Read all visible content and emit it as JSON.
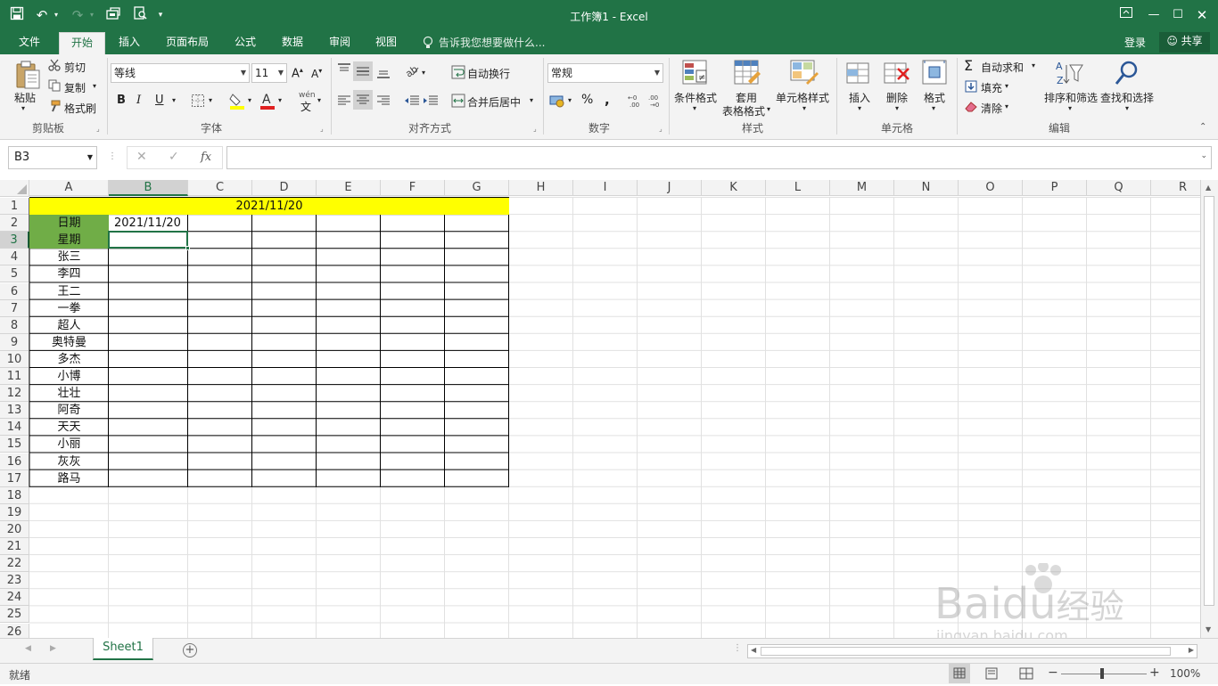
{
  "window": {
    "title": "工作簿1 - Excel"
  },
  "ribbon_tabs": [
    "文件",
    "开始",
    "插入",
    "页面布局",
    "公式",
    "数据",
    "审阅",
    "视图"
  ],
  "active_tab": "开始",
  "tell_me": "告诉我您想要做什么...",
  "account": {
    "login": "登录",
    "share": "共享"
  },
  "clipboard": {
    "paste": "粘贴",
    "cut": "剪切",
    "copy": "复制",
    "format_painter": "格式刷",
    "label": "剪贴板"
  },
  "font": {
    "name": "等线",
    "size": "11",
    "bold": "B",
    "italic": "I",
    "underline": "U",
    "label": "字体",
    "phonetic": "wén"
  },
  "alignment": {
    "wrap_text": "自动换行",
    "merge_center": "合并后居中",
    "label": "对齐方式"
  },
  "number": {
    "format": "常规",
    "percent": "%",
    "comma": ",",
    "label": "数字"
  },
  "styles": {
    "conditional": "条件格式",
    "table_format_1": "套用",
    "table_format_2": "表格格式",
    "cell_styles": "单元格样式",
    "label": "样式"
  },
  "cells": {
    "insert": "插入",
    "delete": "删除",
    "format": "格式",
    "label": "单元格"
  },
  "editing": {
    "autosum": "自动求和",
    "fill": "填充",
    "clear": "清除",
    "sort_filter": "排序和筛选",
    "find_select": "查找和选择",
    "label": "编辑"
  },
  "name_box": "B3",
  "formula": "",
  "columns": [
    "A",
    "B",
    "C",
    "D",
    "E",
    "F",
    "G",
    "H",
    "I",
    "J",
    "K",
    "L",
    "M",
    "N",
    "O",
    "P",
    "Q",
    "R"
  ],
  "rows": [
    "1",
    "2",
    "3",
    "4",
    "5",
    "6",
    "7",
    "8",
    "9",
    "10",
    "11",
    "12",
    "13",
    "14",
    "15",
    "16",
    "17",
    "18",
    "19",
    "20",
    "21",
    "22",
    "23",
    "24",
    "25",
    "26"
  ],
  "sheet": {
    "header": "2021/11/20",
    "date_label": "日期",
    "date_value": "2021/11/20",
    "weekday_label": "星期",
    "names": [
      "张三",
      "李四",
      "王二",
      "一拳",
      "超人",
      "奥特曼",
      "多杰",
      "小博",
      "壮壮",
      "阿奇",
      "天天",
      "小丽",
      "灰灰",
      "路马"
    ]
  },
  "colors": {
    "header_fill": "#ffff00",
    "label_fill": "#70ad47",
    "brand": "#217346"
  },
  "sheet_tabs": [
    "Sheet1"
  ],
  "status": {
    "ready": "就绪",
    "zoom": "100%"
  },
  "watermark": {
    "text1": "Bai",
    "text2": "du",
    "text3": "经验",
    "url": "jingyan.baidu.com"
  }
}
